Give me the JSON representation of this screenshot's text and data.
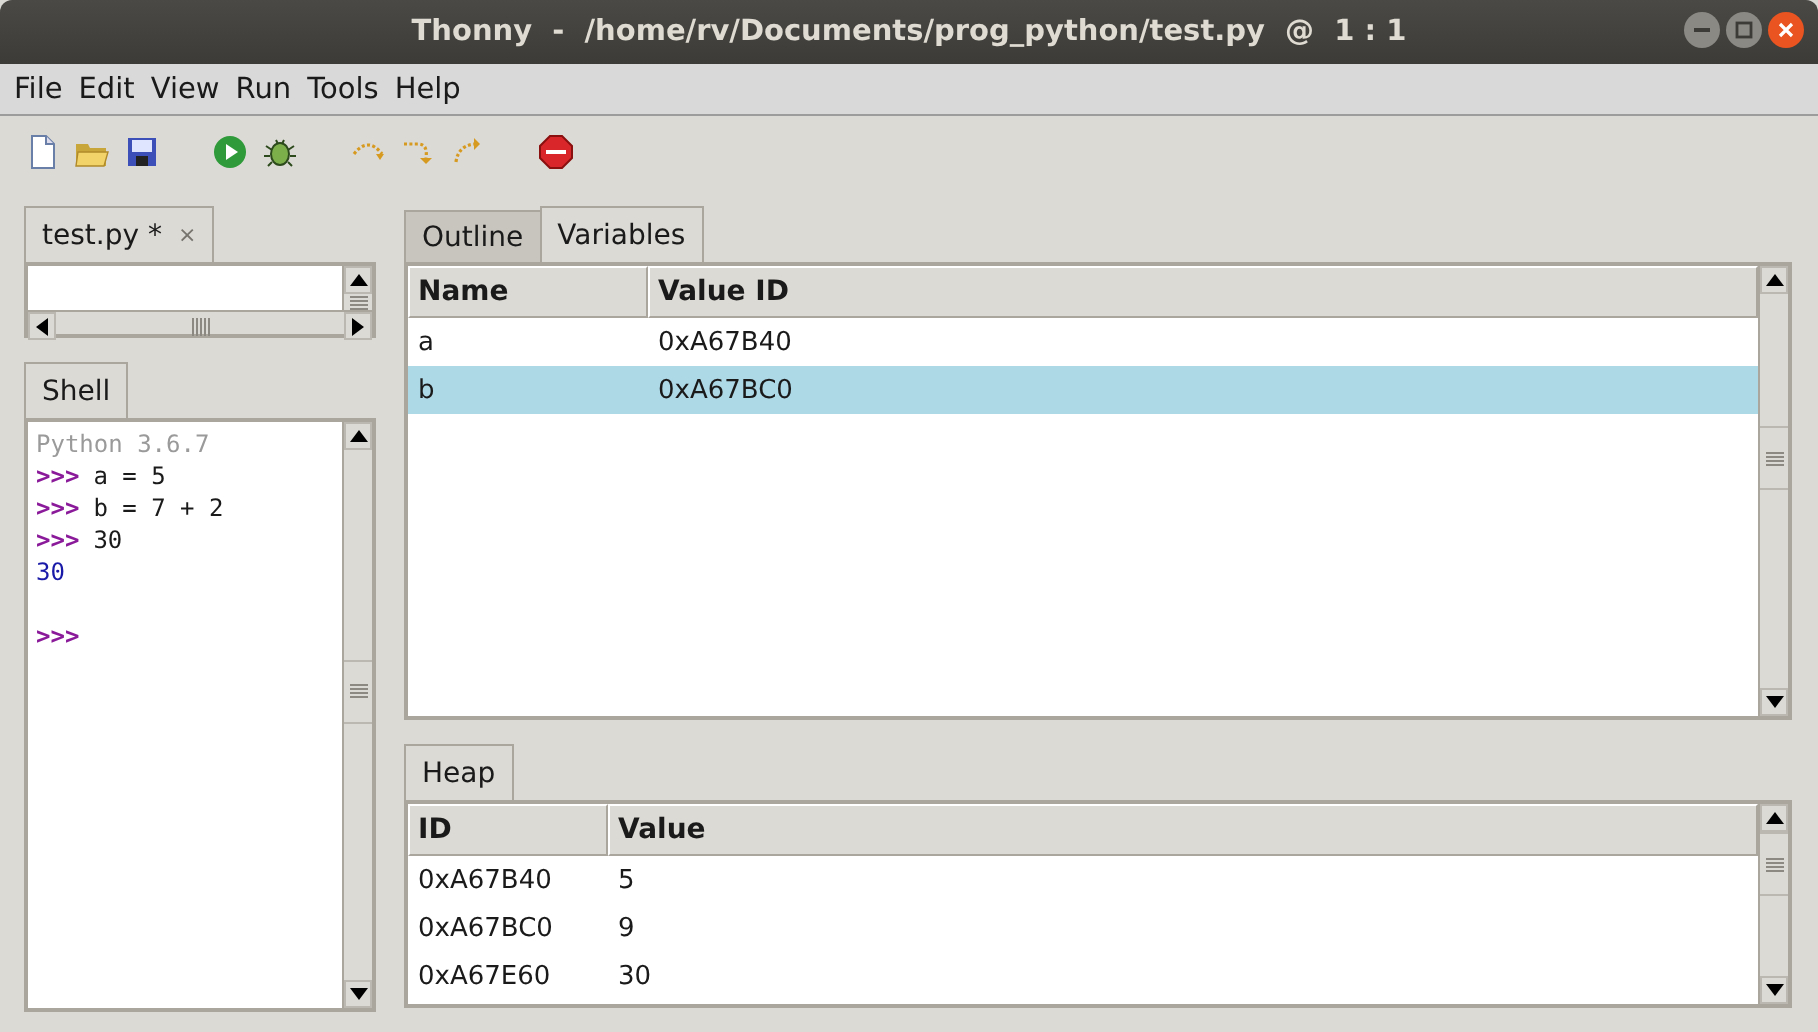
{
  "window": {
    "title": "Thonny  -  /home/rv/Documents/prog_python/test.py  @  1 : 1"
  },
  "menu": [
    "File",
    "Edit",
    "View",
    "Run",
    "Tools",
    "Help"
  ],
  "editor": {
    "tabs": [
      {
        "label": "test.py *",
        "close": "×",
        "selected": true
      }
    ]
  },
  "shell": {
    "tabs": [
      {
        "label": "Shell",
        "selected": true
      }
    ],
    "lines": [
      {
        "kind": "banner",
        "text": "Python 3.6.7"
      },
      {
        "kind": "input",
        "prompt": ">>>",
        "text": "a = 5"
      },
      {
        "kind": "input",
        "prompt": ">>>",
        "text": "b = 7 + 2"
      },
      {
        "kind": "input",
        "prompt": ">>>",
        "text": "30"
      },
      {
        "kind": "output",
        "text": "30"
      },
      {
        "kind": "blank"
      },
      {
        "kind": "input",
        "prompt": ">>>"
      }
    ]
  },
  "variables": {
    "tabs": [
      {
        "label": "Outline",
        "selected": false
      },
      {
        "label": "Variables",
        "selected": true
      }
    ],
    "columns": [
      "Name",
      "Value ID"
    ],
    "rows": [
      {
        "cells": [
          "a",
          "0xA67B40"
        ],
        "selected": false
      },
      {
        "cells": [
          "b",
          "0xA67BC0"
        ],
        "selected": true
      }
    ]
  },
  "heap": {
    "tabs": [
      {
        "label": "Heap",
        "selected": true
      }
    ],
    "columns": [
      "ID",
      "Value"
    ],
    "rows": [
      {
        "cells": [
          "0xA67B40",
          "5"
        ],
        "selected": false
      },
      {
        "cells": [
          "0xA67BC0",
          "9"
        ],
        "selected": false
      },
      {
        "cells": [
          "0xA67E60",
          "30"
        ],
        "selected": false
      }
    ]
  }
}
